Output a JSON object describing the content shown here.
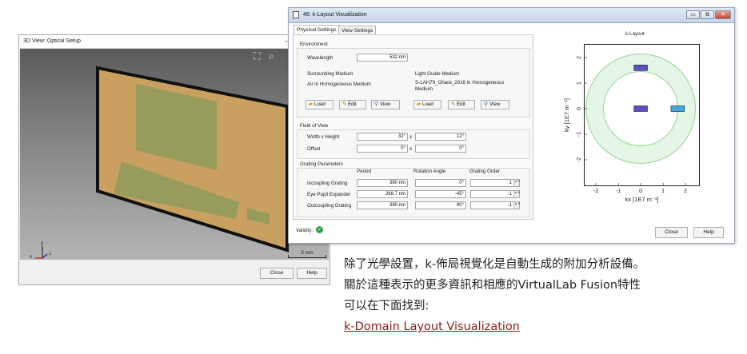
{
  "view3d": {
    "title": "3D View: Optical Setup",
    "min_glyph": "–",
    "scale_label": "5 mm",
    "axes": {
      "y": "y",
      "x": "x",
      "z": "z"
    },
    "close_label": "Close",
    "help_label": "Help",
    "icons": [
      "zoom-fit-icon",
      "zoom-icon"
    ]
  },
  "klayout": {
    "title": "46: k-Layout Visualization",
    "tabs": [
      "Physical Settings",
      "View Settings"
    ],
    "environment": {
      "group_label": "Environment",
      "wavelength_label": "Wavelength",
      "wavelength_value": "532 nm",
      "surrounding": {
        "label": "Surrounding Medium",
        "value": "Air in Homogeneous Medium"
      },
      "light_guide": {
        "label": "Light Guide Medium",
        "value": "S-LAH79_Ohara_2016 in Homogeneous Medium"
      },
      "buttons": {
        "load": "Load",
        "edit": "Edit",
        "view": "View"
      }
    },
    "fov": {
      "group_label": "Field of View",
      "width_height_label": "Width x Height",
      "width_value": "32°",
      "height_value": "12°",
      "offset_label": "Offset",
      "offset_x": "0°",
      "offset_y": "0°",
      "x_sep": "x"
    },
    "grating": {
      "group_label": "Grating Parameters",
      "headers": [
        "Period",
        "Rotation Angle",
        "Grating Order"
      ],
      "rows": [
        {
          "name": "Incoupling Grating",
          "period": "380 nm",
          "angle": "0°",
          "order": "1"
        },
        {
          "name": "Eye Pupil Expander",
          "period": "268.7 nm",
          "angle": "-45°",
          "order": "-1"
        },
        {
          "name": "Outcoupling Grating",
          "period": "380 nm",
          "angle": "90°",
          "order": "-1"
        }
      ]
    },
    "validity_label": "Validity:",
    "close_label": "Close",
    "help_label": "Help",
    "colors": {
      "ring": "#8fd88f",
      "ring_fill": "#e6f6e6",
      "rect_dark": "#5b4fc4",
      "rect_light": "#3fa8e0"
    }
  },
  "chart_data": {
    "type": "scatter",
    "title": "k-Layout",
    "xlabel": "kx [1E7 m⁻¹]",
    "ylabel": "ky [1E7 m⁻¹]",
    "xlim": [
      -2.5,
      2.6
    ],
    "ylim": [
      -3.0,
      2.5
    ],
    "xticks": [
      "-2",
      "-1",
      "0",
      "1",
      "2"
    ],
    "yticks": [
      "2",
      "1",
      "0",
      "-1",
      "-2"
    ],
    "rings": [
      {
        "name": "inner",
        "radius": 1.66
      },
      {
        "name": "outer",
        "radius": 2.44
      }
    ],
    "regions": [
      {
        "center": [
          0,
          1.6
        ],
        "width": 0.6,
        "height": 0.25,
        "color": "#5b4fc4"
      },
      {
        "center": [
          0,
          0
        ],
        "width": 0.6,
        "height": 0.25,
        "color": "#5b4fc4"
      },
      {
        "center": [
          1.65,
          0
        ],
        "width": 0.6,
        "height": 0.25,
        "color": "#3fa8e0"
      }
    ]
  },
  "caption": {
    "line1": "除了光學設置，k-佈局視覺化是自動生成的附加分析設備。",
    "line2": "關於這種表示的更多資訊和相應的VirtualLab Fusion特性",
    "line3": "可以在下面找到:",
    "link": "k-Domain Layout Visualization"
  }
}
